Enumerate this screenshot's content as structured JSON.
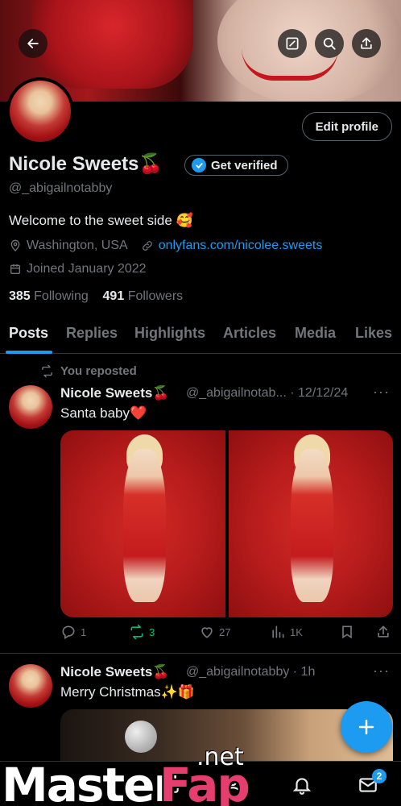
{
  "profile": {
    "name": "Nicole Sweets🍒",
    "get_verified": "Get verified",
    "handle": "@_abigailnotabby",
    "bio": "Welcome to the sweet side 🥰",
    "location": "Washington, USA",
    "link": "onlyfans.com/nicolee.sweets",
    "joined": "Joined January 2022",
    "following_count": "385",
    "following_label": "Following",
    "followers_count": "491",
    "followers_label": "Followers",
    "edit_profile": "Edit profile"
  },
  "tabs": [
    "Posts",
    "Replies",
    "Highlights",
    "Articles",
    "Media",
    "Likes"
  ],
  "posts": [
    {
      "repost_label": "You reposted",
      "name": "Nicole Sweets🍒",
      "handle": "@_abigailnotab...",
      "sep": "·",
      "date": "12/12/24",
      "text": "Santa baby❤️",
      "replies": "1",
      "reposts": "3",
      "likes": "27",
      "views": "1K"
    },
    {
      "name": "Nicole Sweets🍒",
      "handle": "@_abigailnotabby",
      "sep": "·",
      "date": "1h",
      "text": "Merry Christmas✨🎁"
    }
  ],
  "nav": {
    "messages_badge": "2"
  },
  "watermark": {
    "part1": "Master",
    "part2": "Fap",
    "part3": ".net"
  },
  "colors": {
    "accent": "#1d9bf0",
    "repost_green": "#00ba7c",
    "muted": "#71767b",
    "background": "#000000"
  },
  "icons": [
    "back-arrow-icon",
    "grok-icon",
    "search-icon",
    "share-icon",
    "location-icon",
    "link-icon",
    "calendar-icon",
    "repost-icon",
    "reply-icon",
    "like-icon",
    "views-icon",
    "bookmark-icon",
    "more-icon",
    "compose-icon",
    "bell-icon",
    "mail-icon"
  ]
}
